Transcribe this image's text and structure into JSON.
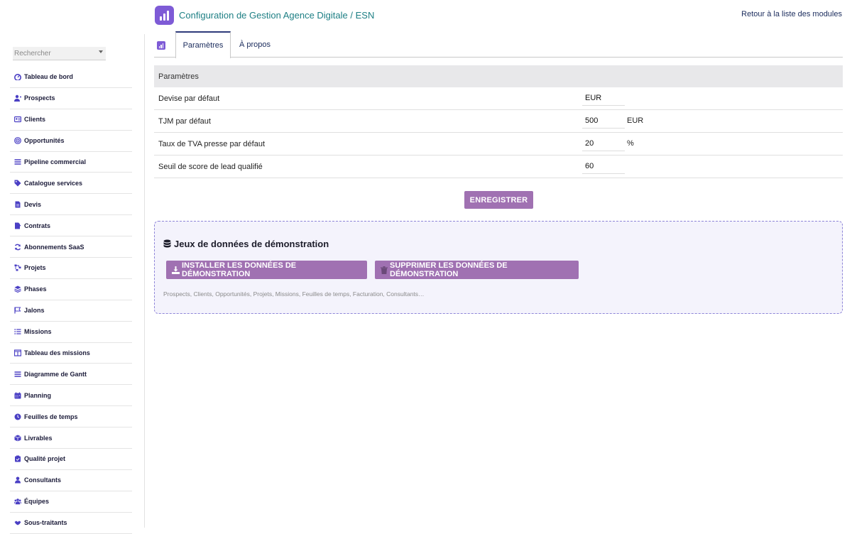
{
  "header": {
    "title": "Configuration de Gestion Agence Digitale / ESN",
    "back_link": "Retour à la liste des modules"
  },
  "sidebar": {
    "search_placeholder": "Rechercher",
    "items": [
      {
        "label": "Tableau de bord",
        "icon": "dashboard-icon"
      },
      {
        "label": "Prospects",
        "icon": "user-plus-icon"
      },
      {
        "label": "Clients",
        "icon": "id-card-icon"
      },
      {
        "label": "Opportunités",
        "icon": "target-icon"
      },
      {
        "label": "Pipeline commercial",
        "icon": "bars-icon"
      },
      {
        "label": "Catalogue services",
        "icon": "tags-icon"
      },
      {
        "label": "Devis",
        "icon": "document-icon"
      },
      {
        "label": "Contrats",
        "icon": "file-signature-icon"
      },
      {
        "label": "Abonnements SaaS",
        "icon": "refresh-icon"
      },
      {
        "label": "Projets",
        "icon": "project-diagram-icon"
      },
      {
        "label": "Phases",
        "icon": "layers-icon"
      },
      {
        "label": "Jalons",
        "icon": "flag-icon"
      },
      {
        "label": "Missions",
        "icon": "list-icon"
      },
      {
        "label": "Tableau des missions",
        "icon": "columns-icon"
      },
      {
        "label": "Diagramme de Gantt",
        "icon": "gantt-icon"
      },
      {
        "label": "Planning",
        "icon": "calendar-icon"
      },
      {
        "label": "Feuilles de temps",
        "icon": "clock-icon"
      },
      {
        "label": "Livrables",
        "icon": "box-icon"
      },
      {
        "label": "Qualité projet",
        "icon": "clipboard-check-icon"
      },
      {
        "label": "Consultants",
        "icon": "user-icon"
      },
      {
        "label": "Équipes",
        "icon": "users-icon"
      },
      {
        "label": "Sous-traitants",
        "icon": "handshake-icon"
      }
    ]
  },
  "tabs": [
    {
      "label": "Paramètres",
      "active": true
    },
    {
      "label": "À propos",
      "active": false
    }
  ],
  "settings": {
    "header": "Paramètres",
    "rows": [
      {
        "label": "Devise par défaut",
        "value": "EUR",
        "unit": ""
      },
      {
        "label": "TJM par défaut",
        "value": "500",
        "unit": "EUR"
      },
      {
        "label": "Taux de TVA presse par défaut",
        "value": "20",
        "unit": "%"
      },
      {
        "label": "Seuil de score de lead qualifié",
        "value": "60",
        "unit": ""
      }
    ],
    "save_label": "ENREGISTRER"
  },
  "demo": {
    "title": "Jeux de données de démonstration",
    "install_label": "INSTALLER LES DONNÉES DE DÉMONSTRATION",
    "delete_label": "SUPPRIMER LES DONNÉES DE DÉMONSTRATION",
    "note": "Prospects, Clients, Opportunités, Projets, Missions, Feuilles de temps, Facturation, Consultants…"
  },
  "colors": {
    "accent": "#7e5bd6",
    "button": "#a071b2",
    "title": "#1d7f84",
    "menu_icon": "#4a3fc4"
  }
}
